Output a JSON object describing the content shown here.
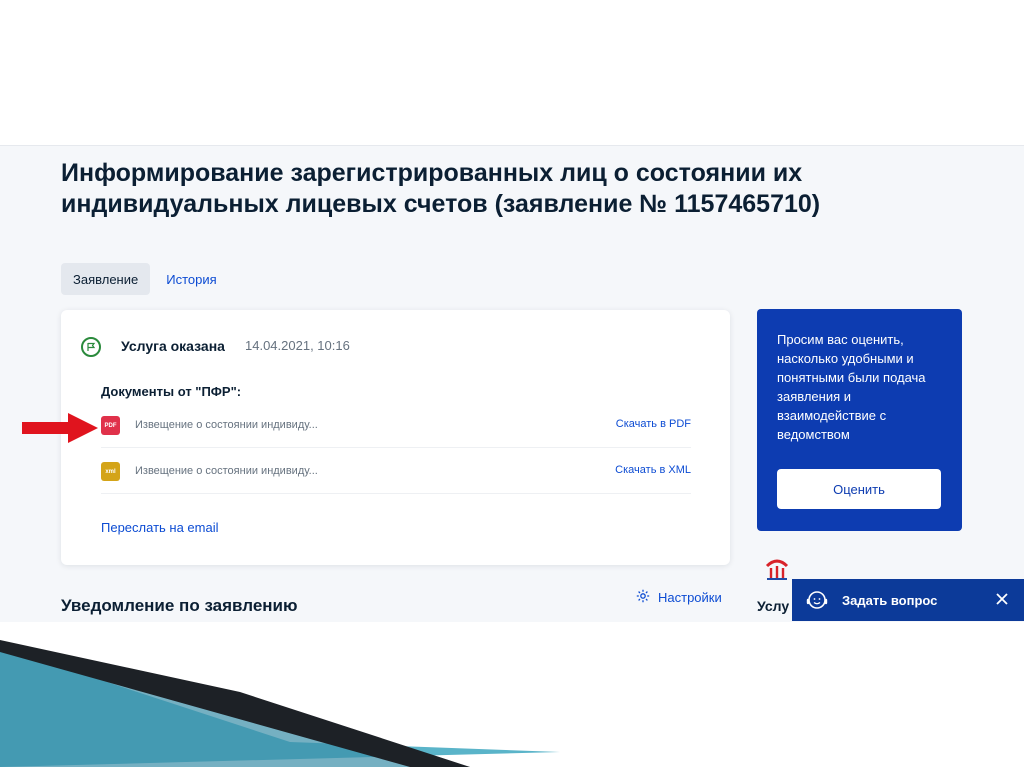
{
  "header": {
    "title": "Информирование зарегистрированных лиц о состоянии их индивидуальных лицевых счетов (заявление № 1157465710)"
  },
  "tabs": [
    {
      "label": "Заявление",
      "active": true
    },
    {
      "label": "История",
      "active": false
    }
  ],
  "status": {
    "label": "Услуга оказана",
    "datetime": "14.04.2021, 10:16",
    "color": "#2a8a3c"
  },
  "documents": {
    "title": "Документы от \"ПФР\":",
    "items": [
      {
        "type_label": "PDF",
        "name": "Извещение о состоянии индивиду...",
        "action": "Скачать в PDF",
        "color": "#e0314a"
      },
      {
        "type_label": "xml",
        "name": "Извещение о состоянии индивиду...",
        "action": "Скачать в XML",
        "color": "#d4a418"
      }
    ],
    "email_link": "Переслать на email"
  },
  "rating": {
    "text": "Просим вас оценить, насколько удобными и понятными были подача заявления и взаимодействие с ведомством",
    "button": "Оценить",
    "background": "#0d3cb1"
  },
  "notice": {
    "title": "Уведомление по заявлению",
    "settings_label": "Настройки",
    "service_partial": "Услу"
  },
  "chat": {
    "label": "Задать вопрос",
    "background": "#0c3a99"
  },
  "icons": {
    "status": "flag-circle-icon",
    "settings": "gear-icon",
    "chat": "operator-headset-icon",
    "close": "close-icon",
    "logo": "pfr-logo-icon",
    "annotation": "red-arrow-icon"
  }
}
